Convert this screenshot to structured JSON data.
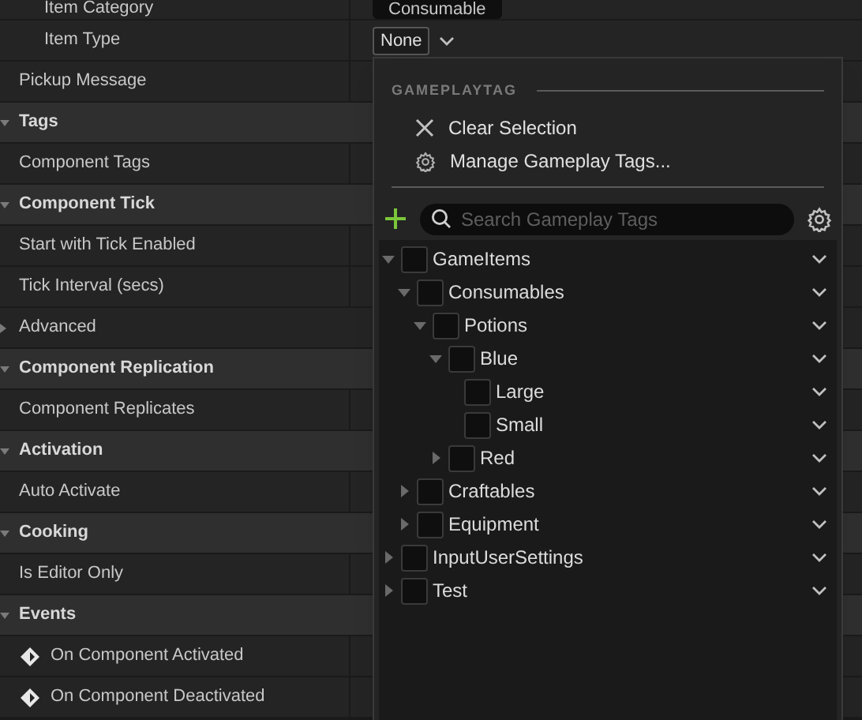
{
  "details": [
    {
      "kind": "subproperty",
      "label": "Item Category",
      "value": "Consumable"
    },
    {
      "kind": "subproperty",
      "label": "Item Type",
      "value": "None"
    },
    {
      "kind": "property",
      "label": "Pickup Message"
    },
    {
      "kind": "category",
      "label": "Tags",
      "expanded": true
    },
    {
      "kind": "property",
      "label": "Component Tags"
    },
    {
      "kind": "category",
      "label": "Component Tick",
      "expanded": true
    },
    {
      "kind": "property",
      "label": "Start with Tick Enabled"
    },
    {
      "kind": "property",
      "label": "Tick Interval (secs)"
    },
    {
      "kind": "advanced",
      "label": "Advanced",
      "expanded": false
    },
    {
      "kind": "category",
      "label": "Component Replication",
      "expanded": true
    },
    {
      "kind": "property",
      "label": "Component Replicates"
    },
    {
      "kind": "category",
      "label": "Activation",
      "expanded": true
    },
    {
      "kind": "property",
      "label": "Auto Activate"
    },
    {
      "kind": "category",
      "label": "Cooking",
      "expanded": true
    },
    {
      "kind": "property",
      "label": "Is Editor Only"
    },
    {
      "kind": "category",
      "label": "Events",
      "expanded": true
    },
    {
      "kind": "event",
      "label": "On Component Activated"
    },
    {
      "kind": "event",
      "label": "On Component Deactivated"
    }
  ],
  "tag_picker": {
    "header": "GAMEPLAYTAG",
    "actions": [
      {
        "kind": "clear",
        "label": "Clear Selection"
      },
      {
        "kind": "manage",
        "label": "Manage Gameplay Tags..."
      }
    ],
    "search": {
      "placeholder": "Search Gameplay Tags"
    },
    "tree": [
      {
        "label": "GameItems",
        "checked": false,
        "expanded": true,
        "children": [
          {
            "label": "Consumables",
            "checked": false,
            "expanded": true,
            "children": [
              {
                "label": "Potions",
                "checked": false,
                "expanded": true,
                "children": [
                  {
                    "label": "Blue",
                    "checked": false,
                    "expanded": true,
                    "children": [
                      {
                        "label": "Large",
                        "checked": false
                      },
                      {
                        "label": "Small",
                        "checked": false
                      }
                    ]
                  },
                  {
                    "label": "Red",
                    "checked": false,
                    "expanded": false
                  }
                ]
              }
            ]
          },
          {
            "label": "Craftables",
            "checked": false,
            "expanded": false
          },
          {
            "label": "Equipment",
            "checked": false,
            "expanded": false
          }
        ]
      },
      {
        "label": "InputUserSettings",
        "checked": false,
        "expanded": false
      },
      {
        "label": "Test",
        "checked": false,
        "expanded": false
      }
    ]
  }
}
